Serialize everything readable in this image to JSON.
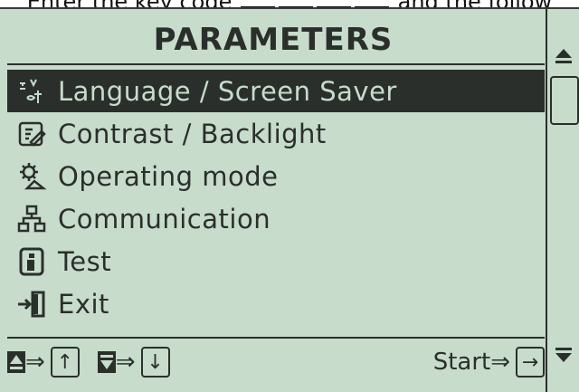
{
  "caption": {
    "prefix": "Enter the key code",
    "suffix": "and the follow"
  },
  "screen": {
    "title": "PARAMETERS",
    "menu": [
      {
        "label": "Language / Screen Saver",
        "icon": "language-icon",
        "selected": true
      },
      {
        "label": "Contrast / Backlight",
        "icon": "contrast-icon",
        "selected": false
      },
      {
        "label": "Operating mode",
        "icon": "gear-icon",
        "selected": false
      },
      {
        "label": "Communication",
        "icon": "network-icon",
        "selected": false
      },
      {
        "label": "Test",
        "icon": "info-icon",
        "selected": false
      },
      {
        "label": "Exit",
        "icon": "exit-door-icon",
        "selected": false
      }
    ],
    "footer": {
      "up_hint_arrow": "⇒",
      "up_key": "↑",
      "down_hint_arrow": "⇒",
      "down_key": "↓",
      "start_label": "Start⇒",
      "start_key": "→"
    }
  },
  "colors": {
    "lcd_bg": "#c7dccb",
    "lcd_fg": "#2b2f2c"
  }
}
